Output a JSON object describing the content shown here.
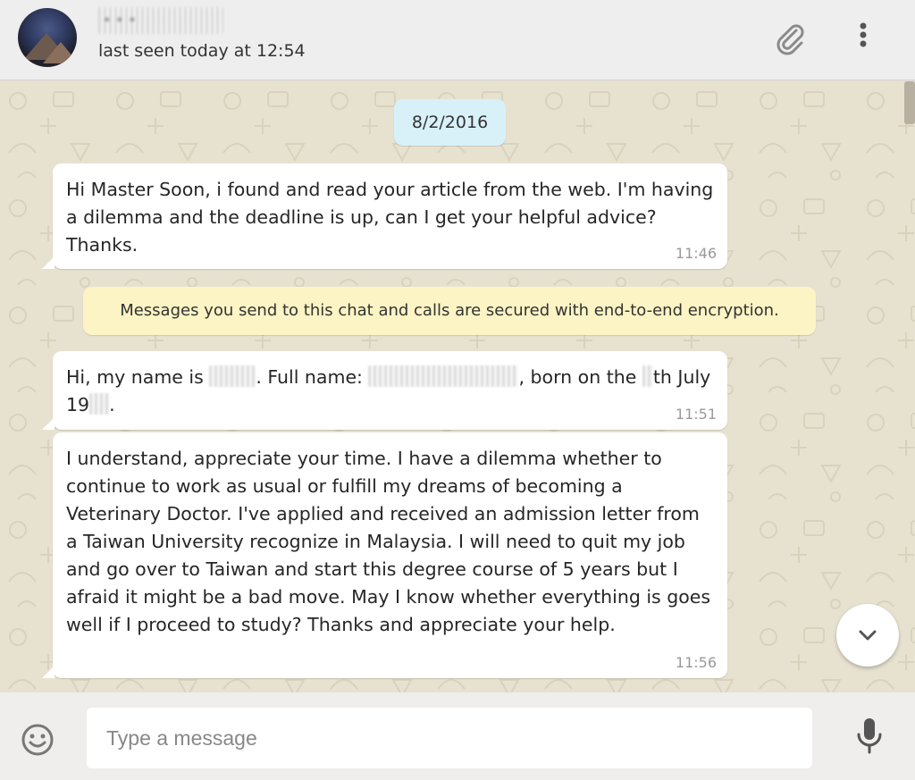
{
  "header": {
    "contact_name": "•••",
    "status": "last seen today at 12:54",
    "attach_icon": "paperclip-icon",
    "menu_icon": "vertical-dots-icon"
  },
  "chat": {
    "date_chip": "8/2/2016",
    "messages": [
      {
        "text": "Hi Master Soon, i found and read your article from the web. I'm having a dilemma and the deadline is up, can I get your helpful advice? Thanks.",
        "time": "11:46"
      },
      {
        "text_parts": [
          "Hi, my name is ",
          ". Full name: ",
          ", born on the ",
          "th July",
          "19",
          "."
        ],
        "time": "11:51"
      },
      {
        "text": "I understand, appreciate your time. I have a dilemma whether to continue to work as usual or fulfill my dreams of becoming a Veterinary Doctor. I've applied and received an admission letter from a Taiwan University recognize in Malaysia. I will need to quit my job and go over to Taiwan and start this degree course of 5 years but I afraid it might be a bad move. May I know whether everything is goes well if I proceed to study? Thanks and appreciate your help.",
        "time": "11:56"
      }
    ],
    "encryption_notice": "Messages you send to this chat and calls are secured with end-to-end encryption."
  },
  "composer": {
    "placeholder": "Type a message",
    "emoji_icon": "smiley-icon",
    "mic_icon": "microphone-icon"
  },
  "colors": {
    "header_bg": "#eeeeee",
    "chat_bg": "#e7e2d0",
    "bubble_bg": "#ffffff",
    "date_chip_bg": "#d8f1f9",
    "encryption_bg": "#fcf4c4",
    "icon_gray": "#8a8a8a"
  }
}
